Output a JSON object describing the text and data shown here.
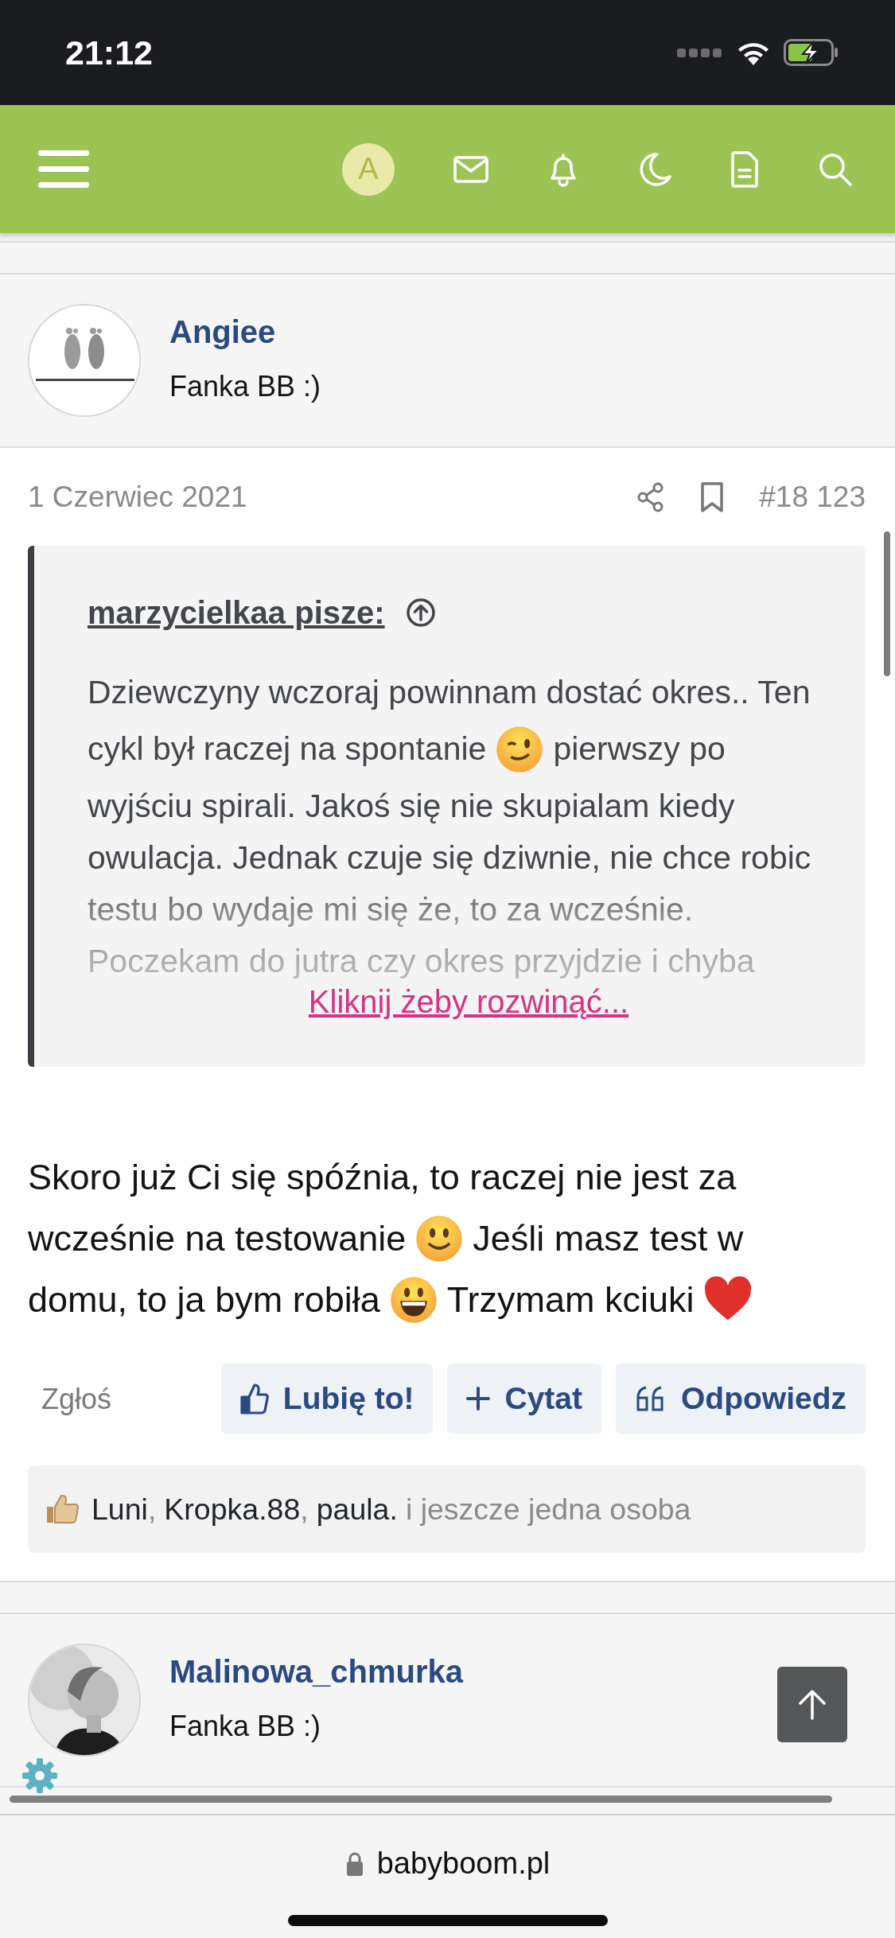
{
  "status_bar": {
    "time": "21:12"
  },
  "navbar": {
    "avatar_letter": "A"
  },
  "posts": [
    {
      "author": "Angiee",
      "title": "Fanka BB :)",
      "date": "1 Czerwiec 2021",
      "number": "#18 123",
      "quote": {
        "author_line": "marzycielkaa pisze:",
        "lines": [
          [
            {
              "kind": "text",
              "text": "Dziewczyny wczoraj powinnam dostać okres.. Ten"
            }
          ],
          [
            {
              "kind": "text",
              "text": "cykl był raczej na spontanie"
            },
            {
              "kind": "wink"
            },
            {
              "kind": "text",
              "text": "pierwszy po"
            }
          ],
          [
            {
              "kind": "text",
              "text": "wyjściu spirali. Jakoś się nie skupialam kiedy"
            }
          ],
          [
            {
              "kind": "text",
              "text": "owulacja. Jednak czuje się dziwnie, nie chce robic"
            }
          ],
          [
            {
              "kind": "text",
              "text": "testu bo wydaje mi się że, to za wcześnie."
            }
          ],
          [
            {
              "kind": "text",
              "text": "Poczekam do jutra czy okres przyjdzie i chyba"
            }
          ]
        ],
        "expand_link": "Kliknij żeby rozwinąć..."
      },
      "message": [
        [
          {
            "kind": "text",
            "text": "Skoro już Ci się spóźnia, to raczej nie jest za"
          }
        ],
        [
          {
            "kind": "text",
            "text": "wcześnie na testowanie"
          },
          {
            "kind": "smile"
          },
          {
            "kind": "text",
            "text": "Jeśli masz test w"
          }
        ],
        [
          {
            "kind": "text",
            "text": "domu, to ja bym robiła"
          },
          {
            "kind": "grin"
          },
          {
            "kind": "text",
            "text": "Trzymam kciuki"
          },
          {
            "kind": "heart"
          }
        ]
      ],
      "report": "Zgłoś",
      "actions": [
        {
          "kind": "like",
          "label": "Lubię to!"
        },
        {
          "kind": "quote",
          "label": "Cytat"
        },
        {
          "kind": "reply",
          "label": "Odpowiedz"
        }
      ],
      "reactions": {
        "users": [
          {
            "name": "Luni",
            "after": ","
          },
          {
            "name": "Kropka.88",
            "after": ","
          },
          {
            "name": "paula."
          }
        ],
        "more": "i jeszcze jedna osoba"
      }
    },
    {
      "author": "Malinowa_chmurka",
      "title": "Fanka BB :)"
    }
  ],
  "browser_bar": {
    "url": "babyboom.pl"
  }
}
